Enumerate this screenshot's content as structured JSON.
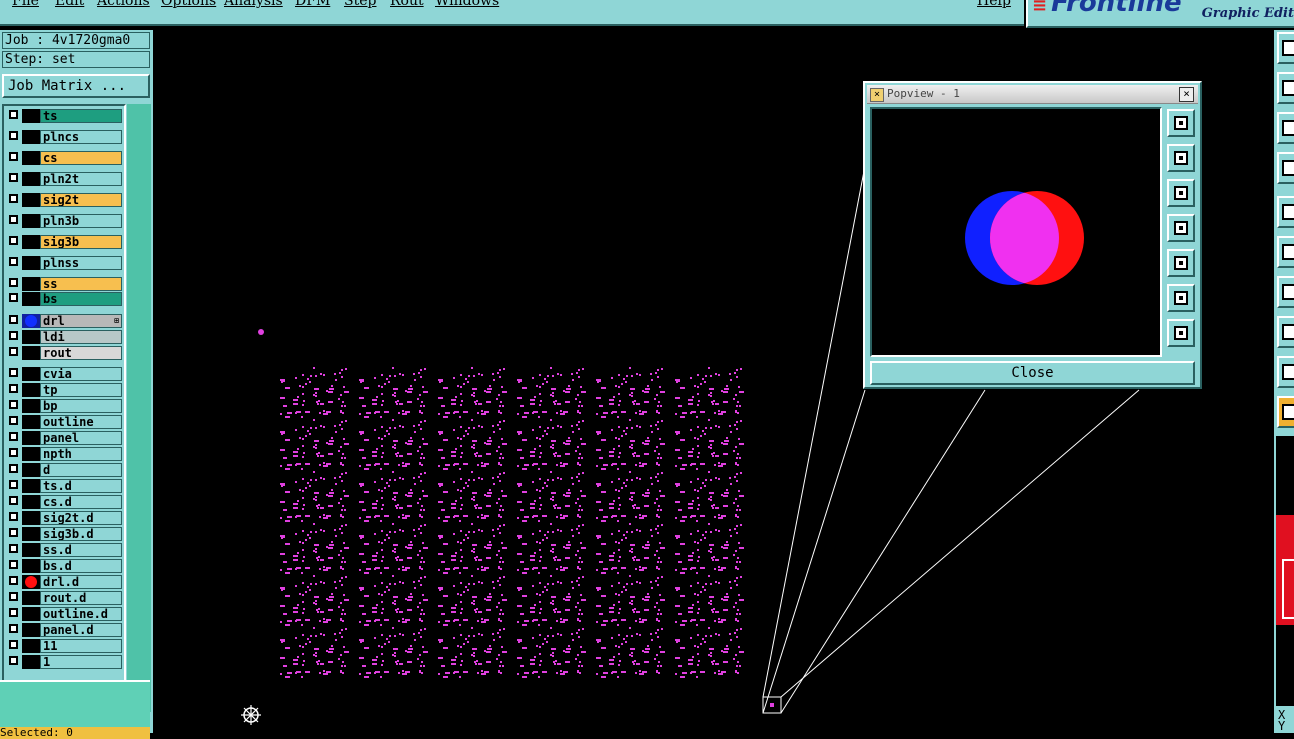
{
  "menubar": {
    "items": [
      "File",
      "Edit",
      "Actions",
      "Options",
      "Analysis",
      "DFM",
      "Step",
      "Rout",
      "Windows"
    ],
    "help": "Help"
  },
  "logo": {
    "brand": "Frontline",
    "subtitle": "Graphic Edit"
  },
  "job": {
    "job_label": "Job : 4v1720gma0",
    "step_label": "Step: set",
    "matrix_button": "Job Matrix ..."
  },
  "layers": [
    {
      "name": "ts",
      "color": "#1e9e80"
    },
    {
      "name": "plncs",
      "color": "#8fd6d6"
    },
    {
      "name": "cs",
      "color": "#f7bf4f"
    },
    {
      "name": "pln2t",
      "color": "#8fd6d6"
    },
    {
      "name": "sig2t",
      "color": "#f7bf4f"
    },
    {
      "name": "pln3b",
      "color": "#8fd6d6"
    },
    {
      "name": "sig3b",
      "color": "#f7bf4f"
    },
    {
      "name": "plnss",
      "color": "#8fd6d6"
    },
    {
      "name": "ss",
      "color": "#f7bf4f"
    },
    {
      "name": "bs",
      "color": "#1e9e80"
    },
    {
      "name": "drl",
      "color": "#b8b8b8",
      "dot": "#1030ff",
      "active": true,
      "mark": "⊞"
    },
    {
      "name": "ldi",
      "color": "#b8c8c8"
    },
    {
      "name": "rout",
      "color": "#d8d8d8"
    },
    {
      "name": "cvia",
      "color": "#8fd6d6"
    },
    {
      "name": "tp",
      "color": "#8fd6d6"
    },
    {
      "name": "bp",
      "color": "#8fd6d6"
    },
    {
      "name": "outline",
      "color": "#8fd6d6"
    },
    {
      "name": "panel",
      "color": "#8fd6d6"
    },
    {
      "name": "npth",
      "color": "#8fd6d6"
    },
    {
      "name": "d",
      "color": "#8fd6d6"
    },
    {
      "name": "ts.d",
      "color": "#8fd6d6"
    },
    {
      "name": "cs.d",
      "color": "#8fd6d6"
    },
    {
      "name": "sig2t.d",
      "color": "#8fd6d6"
    },
    {
      "name": "sig3b.d",
      "color": "#8fd6d6"
    },
    {
      "name": "ss.d",
      "color": "#8fd6d6"
    },
    {
      "name": "bs.d",
      "color": "#8fd6d6"
    },
    {
      "name": "drl.d",
      "color": "#8fd6d6",
      "dot": "#ff1010"
    },
    {
      "name": "rout.d",
      "color": "#8fd6d6"
    },
    {
      "name": "outline.d",
      "color": "#8fd6d6"
    },
    {
      "name": "panel.d",
      "color": "#8fd6d6"
    },
    {
      "name": "11",
      "color": "#8fd6d6"
    },
    {
      "name": "1",
      "color": "#8fd6d6"
    }
  ],
  "select_info": "Selected: 0",
  "popview": {
    "title": "Popview - 1",
    "close_button": "Close",
    "tools": [
      "zoom-fit-icon",
      "pan-up-icon",
      "pan-down-icon",
      "pan-left-icon",
      "pan-right-icon",
      "zoom-out-icon",
      "zoom-in-icon"
    ]
  },
  "right_tools": [
    "tool-1-icon",
    "tool-2-icon",
    "tool-3-icon",
    "tool-4-icon",
    "tool-5-icon",
    "tool-6-icon",
    "tool-7-icon",
    "tool-8-icon",
    "tool-9-icon",
    "tool-10-icon",
    "tool-11-icon"
  ],
  "coords": {
    "x_label": "X",
    "y_label": "Y"
  },
  "colors": {
    "accent": "#8fd6d6",
    "feature": "#e040e0",
    "canvas": "#000000"
  }
}
